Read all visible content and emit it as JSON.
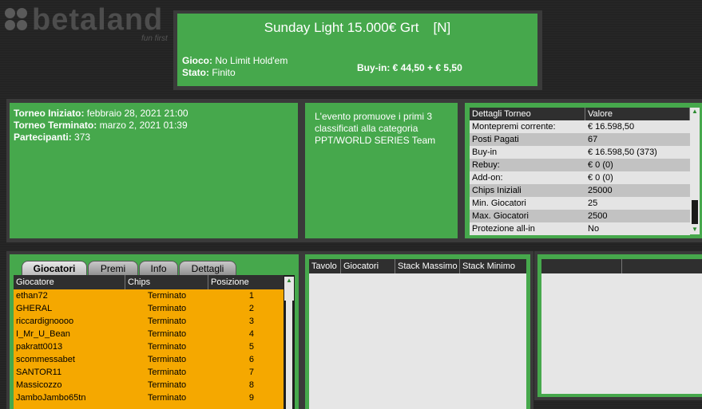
{
  "logo": {
    "text": "betaland",
    "tagline": "fun first"
  },
  "tournament": {
    "title": "Sunday Light 15.000€ Grt",
    "badge": "[N]",
    "game_label": "Gioco:",
    "game_value": "No Limit Hold'em",
    "status_label": "Stato:",
    "status_value": "Finito",
    "buyin_label": "Buy-in:",
    "buyin_value": "€ 44,50 + € 5,50"
  },
  "times": {
    "started_label": "Torneo Iniziato:",
    "started_value": "febbraio 28, 2021 21:00",
    "ended_label": "Torneo Terminato:",
    "ended_value": "marzo 2, 2021 01:39",
    "players_label": "Partecipanti:",
    "players_value": "373"
  },
  "promo": {
    "text": "L'evento promuove i primi 3 classificati alla categoria PPT/WORLD SERIES Team"
  },
  "details": {
    "headers": [
      "Dettagli Torneo",
      "Valore"
    ],
    "rows": [
      [
        "Montepremi corrente:",
        "€ 16.598,50"
      ],
      [
        "Posti Pagati",
        "67"
      ],
      [
        "Buy-in",
        "€ 16.598,50 (373)"
      ],
      [
        "Rebuy:",
        "€ 0 (0)"
      ],
      [
        "Add-on:",
        "€ 0 (0)"
      ],
      [
        "Chips Iniziali",
        "25000"
      ],
      [
        "Min. Giocatori",
        "25"
      ],
      [
        "Max. Giocatori",
        "2500"
      ],
      [
        "Protezione all-in",
        "No"
      ]
    ]
  },
  "tabs": [
    "Giocatori",
    "Premi",
    "Info",
    "Dettagli"
  ],
  "players": {
    "headers": [
      "Giocatore",
      "Chips",
      "Posizione"
    ],
    "rows": [
      [
        "ethan72",
        "Terminato",
        "1"
      ],
      [
        "GHERAL",
        "Terminato",
        "2"
      ],
      [
        "riccardignoooo",
        "Terminato",
        "3"
      ],
      [
        "I_Mr_U_Bean",
        "Terminato",
        "4"
      ],
      [
        "pakratt0013",
        "Terminato",
        "5"
      ],
      [
        "scommessabet",
        "Terminato",
        "6"
      ],
      [
        "SANTOR11",
        "Terminato",
        "7"
      ],
      [
        "Massicozzo",
        "Terminato",
        "8"
      ],
      [
        "JamboJambo65tn",
        "Terminato",
        "9"
      ]
    ]
  },
  "tables": {
    "headers": [
      "Tavolo",
      "Giocatori",
      "Stack Massimo",
      "Stack Minimo"
    ]
  },
  "colors": {
    "panel_green": "#46a84c",
    "row_orange": "#f5a800",
    "frame": "#3a3a3a"
  }
}
